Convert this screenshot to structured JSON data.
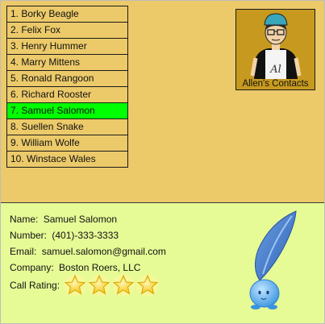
{
  "contacts": [
    {
      "label": "1. Borky Beagle"
    },
    {
      "label": "2. Felix Fox"
    },
    {
      "label": "3. Henry Hummer"
    },
    {
      "label": "4. Marry Mittens"
    },
    {
      "label": "5. Ronald Rangoon"
    },
    {
      "label": "6. Richard Rooster"
    },
    {
      "label": "7. Samuel Salomon"
    },
    {
      "label": "8. Suellen Snake"
    },
    {
      "label": "9. William Wolfe"
    },
    {
      "label": "10. Winstace Wales"
    }
  ],
  "selected_index": 6,
  "owner": {
    "title": "Allen's Contacts",
    "avatar_shirt_text": "Al"
  },
  "details": {
    "name_label": "Name:",
    "name": "Samuel Salomon",
    "number_label": "Number:",
    "number": "(401)-333-3333",
    "email_label": "Email:",
    "email": "samuel.salomon@gmail.com",
    "company_label": "Company:",
    "company": "Boston Roers, LLC",
    "rating_label": "Call Rating:",
    "rating": 4
  },
  "colors": {
    "top_background": "#ecca6a",
    "bottom_background": "#e6fb96",
    "selected_item": "#00ff00",
    "owner_card": "#c79a1f",
    "star": "#f5c518"
  },
  "icons": {
    "avatar": "cartoon-man-avatar-icon",
    "star": "star-icon",
    "mascot": "water-drop-mascot-icon"
  }
}
